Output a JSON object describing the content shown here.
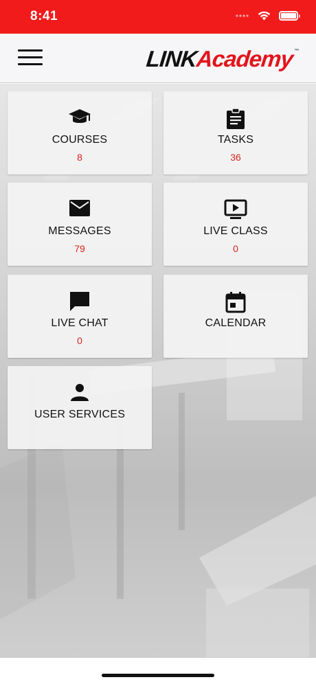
{
  "status_bar": {
    "time": "8:41"
  },
  "header": {
    "logo_part1": "LINK",
    "logo_part2": "Academy",
    "logo_tm": "™"
  },
  "tiles": [
    {
      "label": "COURSES",
      "count": "8",
      "icon": "graduation-cap-icon"
    },
    {
      "label": "TASKS",
      "count": "36",
      "icon": "clipboard-icon"
    },
    {
      "label": "MESSAGES",
      "count": "79",
      "icon": "envelope-icon"
    },
    {
      "label": "LIVE CLASS",
      "count": "0",
      "icon": "play-screen-icon"
    },
    {
      "label": "LIVE CHAT",
      "count": "0",
      "icon": "chat-bubble-icon"
    },
    {
      "label": "CALENDAR",
      "count": "",
      "icon": "calendar-icon"
    },
    {
      "label": "USER SERVICES",
      "count": "",
      "icon": "person-icon"
    }
  ],
  "colors": {
    "status_bar": "#f21b1b",
    "accent": "#e3141b",
    "count_text": "#d9231d"
  }
}
